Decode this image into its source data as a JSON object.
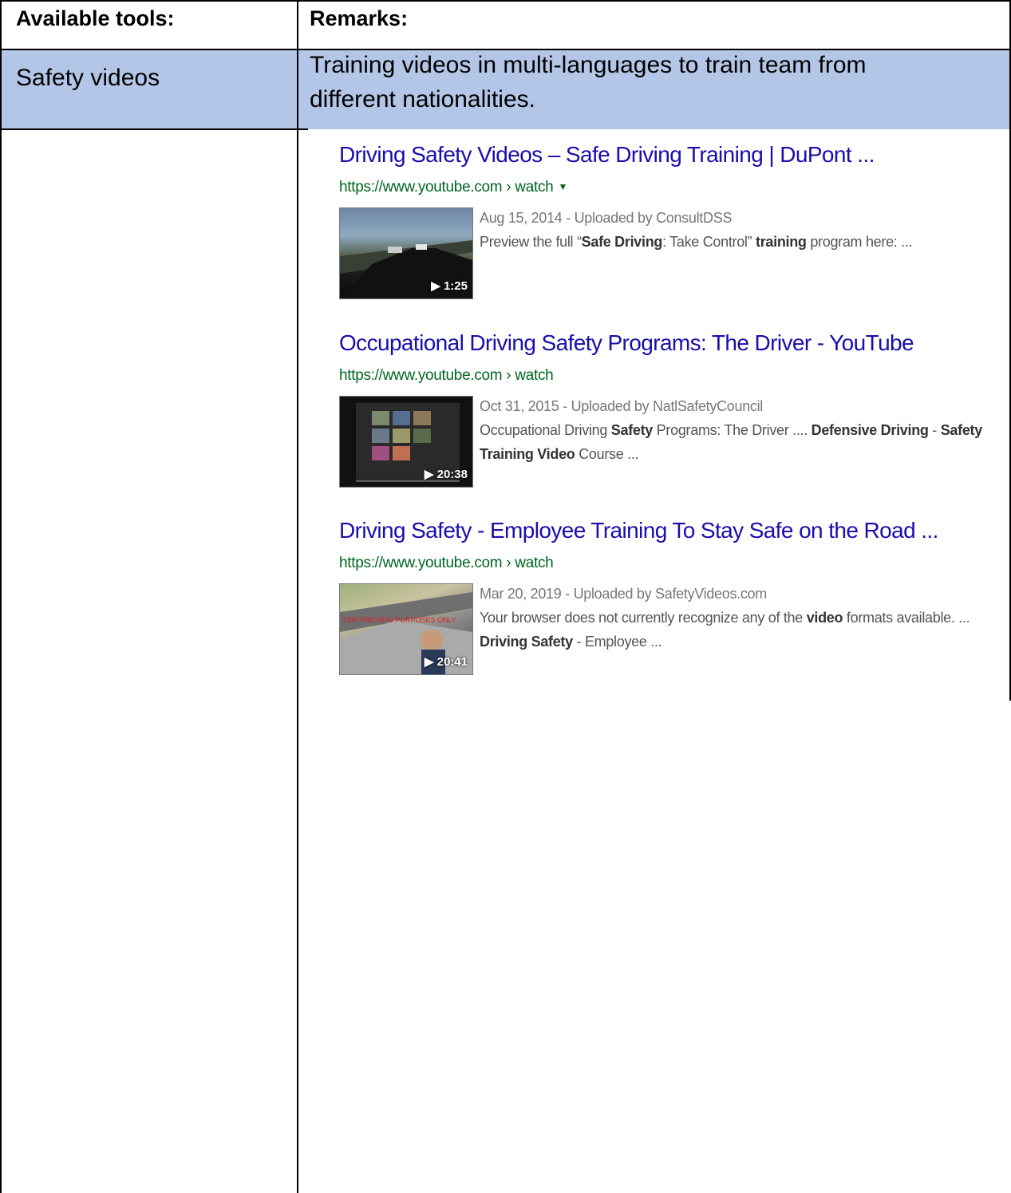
{
  "table": {
    "header": {
      "col1": "Available tools:",
      "col2": "Remarks:"
    },
    "row1": {
      "tool": "Safety videos",
      "remark": "Training videos in multi-languages to train team from different nationalities."
    }
  },
  "results": [
    {
      "title": "Driving Safety Videos – Safe Driving Training | DuPont ...",
      "url": "https://www.youtube.com › watch",
      "has_caret": true,
      "duration": "1:25",
      "date": "Aug 15, 2014 - Uploaded by ConsultDSS",
      "snippet": [
        {
          "t": "Preview the full “",
          "b": false
        },
        {
          "t": "Safe Driving",
          "b": true
        },
        {
          "t": ": Take Control” ",
          "b": false
        },
        {
          "t": "training",
          "b": true
        },
        {
          "t": " program here: ...",
          "b": false
        }
      ]
    },
    {
      "title": "Occupational Driving Safety Programs: The Driver - YouTube",
      "url": "https://www.youtube.com › watch",
      "has_caret": false,
      "duration": "20:38",
      "date": "Oct 31, 2015 - Uploaded by NatlSafetyCouncil",
      "snippet": [
        {
          "t": "Occupational Driving ",
          "b": false
        },
        {
          "t": "Safety",
          "b": true
        },
        {
          "t": " Programs: The Driver .... ",
          "b": false
        },
        {
          "t": "Defensive Driving",
          "b": true
        },
        {
          "t": " - ",
          "b": false
        },
        {
          "t": "Safety Training Video",
          "b": true
        },
        {
          "t": " Course ...",
          "b": false
        }
      ]
    },
    {
      "title": "Driving Safety - Employee Training To Stay Safe on the Road ...",
      "url": "https://www.youtube.com › watch",
      "has_caret": false,
      "duration": "20:41",
      "date": "Mar 20, 2019 - Uploaded by SafetyVideos.com",
      "snippet": [
        {
          "t": "Your browser does not currently recognize any of the ",
          "b": false
        },
        {
          "t": "video",
          "b": true
        },
        {
          "t": " formats available. ... ",
          "b": false
        },
        {
          "t": "Driving Safety",
          "b": true
        },
        {
          "t": " - Employee ...",
          "b": false
        }
      ]
    }
  ],
  "colors": {
    "header_fill": "#b4c6e7",
    "link": "#1a0dab",
    "url": "#006621"
  }
}
